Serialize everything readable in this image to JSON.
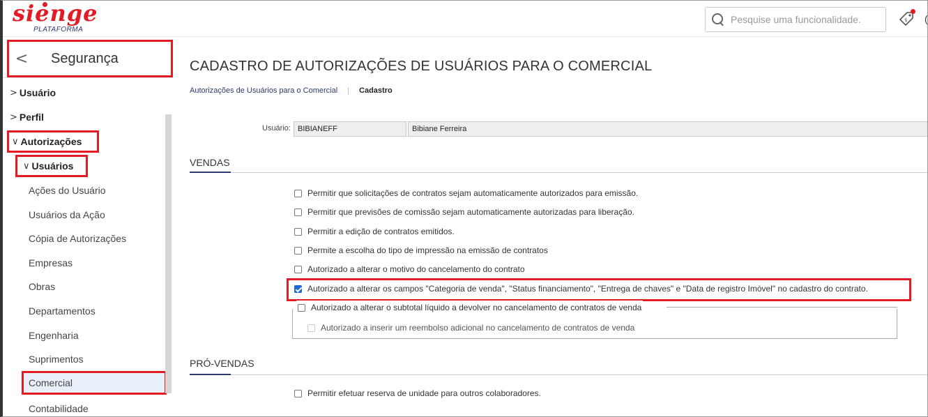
{
  "brand": {
    "logo_text": "sienge",
    "sub_text": "PLATAFORMA",
    "accent_color": "#e31b24"
  },
  "header": {
    "search_placeholder": "Pesquise uma funcionalidade.",
    "edge_letter": "(",
    "tag_icon": "price-tag-icon"
  },
  "sidebar": {
    "back_icon": "<",
    "title": "Segurança",
    "items": [
      {
        "label": "Usuário",
        "chevron": ">"
      },
      {
        "label": "Perfil",
        "chevron": ">"
      },
      {
        "label": "Autorizações",
        "chevron": "∨"
      },
      {
        "label": "Usuários",
        "chevron": "∨"
      }
    ],
    "subitems": [
      "Ações do Usuário",
      "Usuários da Ação",
      "Cópia de Autorizações",
      "Empresas",
      "Obras",
      "Departamentos",
      "Engenharia",
      "Suprimentos",
      "Comercial",
      "Contabilidade"
    ],
    "active_item": "Comercial"
  },
  "main": {
    "title": "CADASTRO DE AUTORIZAÇÕES DE USUÁRIOS PARA O COMERCIAL",
    "breadcrumb": {
      "link": "Autorizações de Usuários para o Comercial",
      "separator": "|",
      "current": "Cadastro"
    },
    "user": {
      "label": "Usuário:",
      "code": "BIBIANEFF",
      "name": "Bibiane Ferreira"
    },
    "sections": [
      {
        "title": "VENDAS",
        "options": [
          {
            "label": "Permitir que solicitações de contratos sejam automaticamente autorizados para emissão.",
            "checked": false
          },
          {
            "label": "Permitir que previsões de comissão sejam automaticamente autorizadas para liberação.",
            "checked": false
          },
          {
            "label": "Permitir a edição de contratos emitidos.",
            "checked": false
          },
          {
            "label": "Permite a escolha do tipo de impressão na emissão de contratos",
            "checked": false
          },
          {
            "label": "Autorizado a alterar o motivo do cancelamento do contrato",
            "checked": false
          },
          {
            "label": "Autorizado a alterar os campos \"Categoria de venda\", \"Status financiamento\", \"Entrega de chaves\" e \"Data de registro Imóvel\" no cadastro do contrato.",
            "checked": true
          },
          {
            "label": "Autorizado a alterar o subtotal líquido a devolver no cancelamento de contratos de venda",
            "checked": false
          },
          {
            "label": "Autorizado a inserir um reembolso adicional no cancelamento de contratos de venda",
            "checked": false,
            "disabled": true
          }
        ]
      },
      {
        "title": "PRÓ-VENDAS",
        "options": [
          {
            "label": "Permitir efetuar reserva de unidade para outros colaboradores.",
            "checked": false
          }
        ]
      }
    ]
  }
}
